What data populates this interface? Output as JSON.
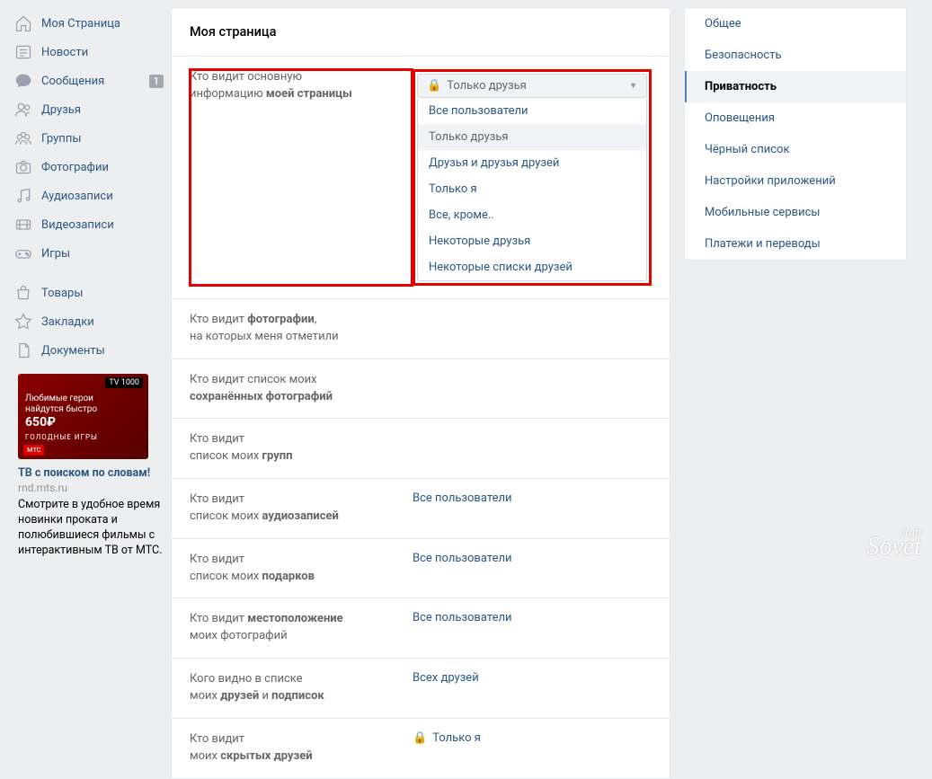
{
  "leftNav": {
    "items": [
      {
        "label": "Моя Страница"
      },
      {
        "label": "Новости"
      },
      {
        "label": "Сообщения",
        "badge": "1"
      },
      {
        "label": "Друзья"
      },
      {
        "label": "Группы"
      },
      {
        "label": "Фотографии"
      },
      {
        "label": "Аудиозаписи"
      },
      {
        "label": "Видеозаписи"
      },
      {
        "label": "Игры"
      }
    ],
    "items2": [
      {
        "label": "Товары"
      },
      {
        "label": "Закладки"
      },
      {
        "label": "Документы"
      }
    ]
  },
  "ad": {
    "imgTop": "TV 1000",
    "imgLine1": "Любимые герои",
    "imgLine2": "найдутся быстро",
    "imgPrice": "650₽",
    "imgMts": "мтс",
    "imgTitle2": "ГОЛОДНЫЕ ИГРЫ",
    "title": "ТВ с поиском по словам!",
    "domain": "rnd.mts.ru",
    "desc": "Смотрите в удобное время новинки проката и полюбившиеся фильмы с интерактивным ТВ от МТС."
  },
  "page": {
    "title": "Моя страница"
  },
  "settings": [
    {
      "l1": "Кто видит основную",
      "l2": "информацию ",
      "lb": "моей страницы",
      "value": "",
      "red": true,
      "dd": true
    },
    {
      "l1": "Кто видит ",
      "lb": "фотографии",
      "lb2": ",",
      "l2": "на которых меня отметили",
      "value": ""
    },
    {
      "l1": "Кто видит список моих",
      "l2": "",
      "lb": "сохранённых фотографий",
      "value": ""
    },
    {
      "l1": "Кто видит",
      "l2": "список моих ",
      "lb": "групп",
      "value": ""
    },
    {
      "l1": "Кто видит",
      "l2": "список моих ",
      "lb": "аудиозаписей",
      "value": "Все пользователи"
    },
    {
      "l1": "Кто видит",
      "l2": "список моих ",
      "lb": "подарков",
      "value": "Все пользователи"
    },
    {
      "l1": "Кто видит ",
      "lb": "местоположение",
      "l2": "моих фотографий",
      "value": "Все пользователи"
    },
    {
      "l1": "Кого видно в списке",
      "l2": "моих ",
      "lb": "друзей",
      "lb3": " и ",
      "lb4": "подписок",
      "value": "Всех друзей"
    },
    {
      "l1": "Кто видит",
      "l2": "моих ",
      "lb": "скрытых друзей",
      "value": "Только я",
      "lock": true
    }
  ],
  "dropdown": {
    "selected": "Только друзья",
    "options": [
      "Все пользователи",
      "Только друзья",
      "Друзья и друзья друзей",
      "Только я",
      "Все, кроме..",
      "Некоторые друзья",
      "Некоторые списки друзей"
    ]
  },
  "rightNav": {
    "items": [
      "Общее",
      "Безопасность",
      "Приватность",
      "Оповещения",
      "Чёрный список",
      "Настройки приложений",
      "Мобильные сервисы",
      "Платежи и переводы"
    ],
    "activeIndex": 2
  },
  "watermark": {
    "small": "club",
    "big": "Sovet"
  },
  "lockGlyph": "🔒"
}
